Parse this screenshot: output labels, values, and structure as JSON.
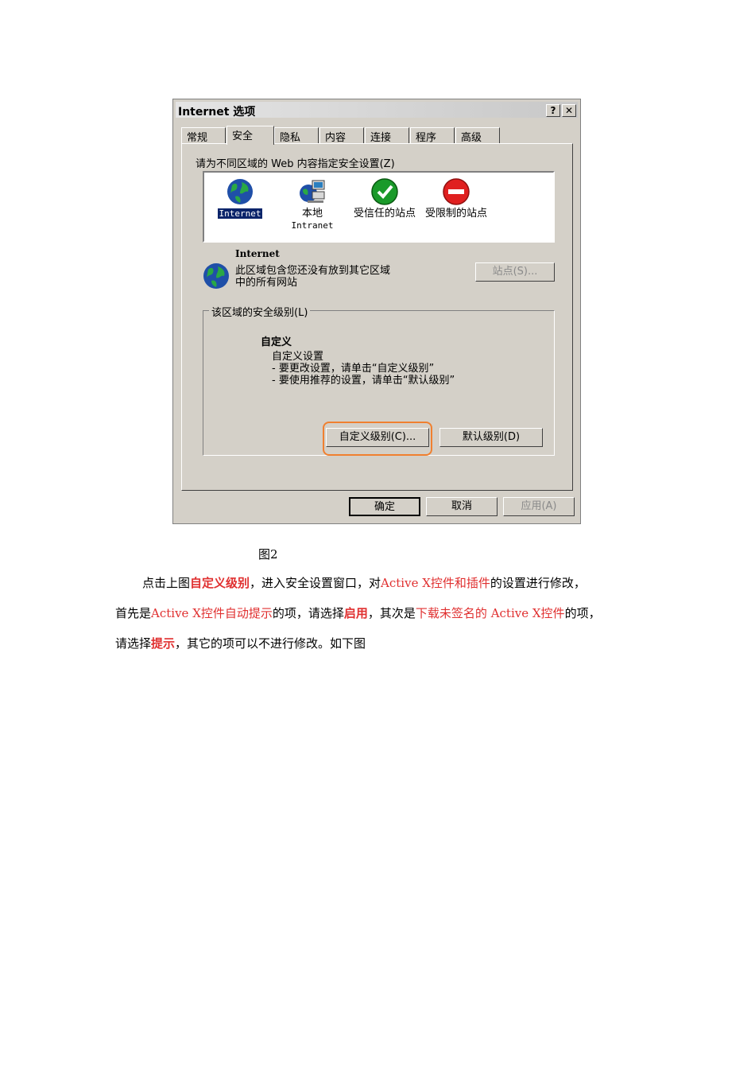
{
  "dialog": {
    "title": "Internet 选项",
    "help_btn": "?",
    "close_btn": "✕",
    "tabs": [
      "常规",
      "安全",
      "隐私",
      "内容",
      "连接",
      "程序",
      "高级"
    ],
    "active_tab": "安全",
    "zone_prompt": "请为不同区域的 Web 内容指定安全设置(Z)",
    "zones": [
      {
        "line1": "Internet",
        "line2": "",
        "icon": "globe-icon"
      },
      {
        "line1": "本地",
        "line2": "Intranet",
        "icon": "intranet-icon"
      },
      {
        "line1": "受信任的站点",
        "line2": "",
        "icon": "trusted-check-icon"
      },
      {
        "line1": "受限制的站点",
        "line2": "",
        "icon": "restricted-icon"
      }
    ],
    "zone_title": "Internet",
    "zone_desc1": "此区域包含您还没有放到其它区域",
    "zone_desc2": "中的所有网站",
    "sites_button": "站点(S)...",
    "group_label": "该区域的安全级别(L)",
    "level_title": "自定义",
    "level_line1": "自定义设置",
    "level_line2": "- 要更改设置，请单击“自定义级别”",
    "level_line3": "- 要使用推荐的设置，请单击“默认级别”",
    "custom_button": "自定义级别(C)...",
    "default_button": "默认级别(D)",
    "ok_button": "确定",
    "cancel_button": "取消",
    "apply_button": "应用(A)",
    "colors": {
      "highlight_outline": "#f08030",
      "selection": "#0a246a"
    }
  },
  "caption": "图2",
  "paragraph": {
    "s1": "点击上图",
    "s2": "自定义级别",
    "s3": "，进入安全设置窗口，对",
    "s4": "Active X控件和插件",
    "s5": "的设置进行修改，",
    "s6": "首先是",
    "s7": "Active X控件自动提示",
    "s8": "的项，请选择",
    "s9": "启用",
    "s10": "，其次是",
    "s11": "下载未签名的 Active X控件",
    "s12": "的项，",
    "s13": "请选择",
    "s14": "提示",
    "s15": "，其它的项可以不进行修改。如下图"
  },
  "colors": {
    "emphasis": "#e03030"
  }
}
